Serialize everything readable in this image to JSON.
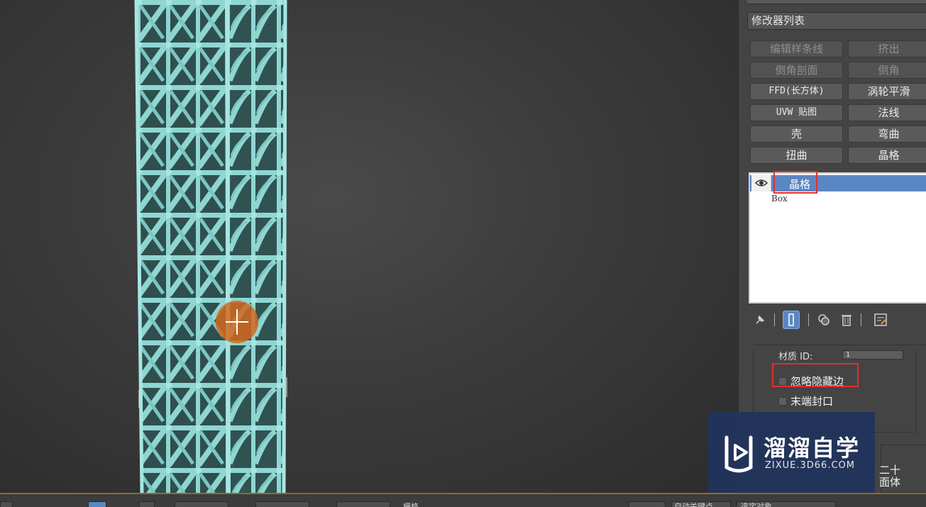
{
  "panel": {
    "modifier_list": "修改器列表",
    "buttons": [
      {
        "label": "编辑样条线",
        "enabled": false
      },
      {
        "label": "挤出",
        "enabled": false
      },
      {
        "label": "倒角剖面",
        "enabled": false
      },
      {
        "label": "倒角",
        "enabled": false
      },
      {
        "label": "FFD(长方体)",
        "enabled": true
      },
      {
        "label": "涡轮平滑",
        "enabled": true
      },
      {
        "label": "UVW 贴图",
        "enabled": true
      },
      {
        "label": "法线",
        "enabled": true
      },
      {
        "label": "壳",
        "enabled": true
      },
      {
        "label": "弯曲",
        "enabled": true
      },
      {
        "label": "扭曲",
        "enabled": true
      },
      {
        "label": "晶格",
        "enabled": true
      }
    ],
    "stack": {
      "selected": "晶格",
      "base": "Box"
    },
    "rollout": {
      "material_id_label": "材质 ID:",
      "material_id_value": "1",
      "ignore_hidden_edges": "忽略隐藏边",
      "end_caps": "末端封口",
      "lower_text_1": "二十",
      "lower_text_2": "面体"
    }
  },
  "watermark": {
    "title": "溜溜自学",
    "subtitle": "ZIXUE.3D66.COM"
  },
  "statusbar": {
    "grid_label": "栅格",
    "auto_key": "自动关键点",
    "selection_set": "选定对象"
  },
  "colors": {
    "lattice": "#8fd6d2",
    "selection_blue": "#5b86c4",
    "highlight_red": "#e0302a",
    "cursor_orange": "#d2691e"
  }
}
